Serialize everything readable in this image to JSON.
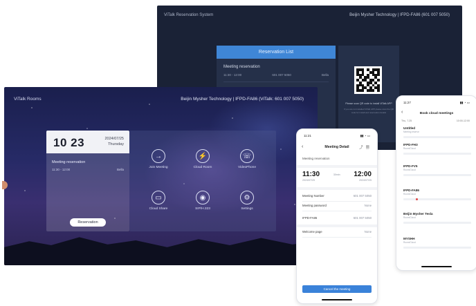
{
  "back_screen": {
    "title": "ViTalk Reservation System",
    "company": "Beijin Mysher Technology  |  IFPD-FA86  (601 007 5050)",
    "panel_title": "Reservation List",
    "reservation": {
      "title": "Meeting reservation",
      "time": "11:30 - 12:00",
      "id": "601 007 5050",
      "user": "Bella"
    },
    "qr_caption": "Please scan QR code to install ViTalk APP",
    "qr_note": "If you are not installed ViTalk APP please scan the QR code for install and reservation details"
  },
  "main_screen": {
    "title": "ViTalk Rooms",
    "company": "Beijin Mysher Technology  |  IFPD-FA86  (ViTalk: 601 007 5050)",
    "clock": {
      "time": "10 23",
      "date": "2024/07/25",
      "weekday": "Thursday"
    },
    "reservation": {
      "title": "Meeting reservation",
      "time": "11:30 - 12:00",
      "user": "Bella"
    },
    "reservation_button": "Reservation",
    "functions": [
      {
        "label": "Join Meeting",
        "icon": "arrow-right-icon",
        "glyph": "→"
      },
      {
        "label": "Cloud Room",
        "icon": "lightning-icon",
        "glyph": "⚡"
      },
      {
        "label": "VideoPhone",
        "icon": "phone-icon",
        "glyph": "☏"
      },
      {
        "label": "Cloud Share",
        "icon": "screen-share-icon",
        "glyph": "▭"
      },
      {
        "label": "SIP/H.323",
        "icon": "sip-icon",
        "glyph": "◉"
      },
      {
        "label": "Settings",
        "icon": "gear-icon",
        "glyph": "⚙"
      }
    ]
  },
  "phone_meeting": {
    "status_time": "11:21",
    "status_icons": "▮▮ ◔ ▭",
    "nav_title": "Meeting Detail",
    "subject": "Meeting reservation",
    "start_time": "11:30",
    "start_date": "2024/07/25",
    "duration": "30min",
    "end_time": "12:00",
    "end_date": "2024/07/25",
    "rows": [
      {
        "label": "Meeting Number",
        "value": "601 007 5050"
      },
      {
        "label": "Meeting password",
        "value": "None"
      },
      {
        "label": "IFPD-FA86",
        "value": "601 007 5050"
      },
      {
        "label": "Welcome page",
        "value": "None"
      }
    ],
    "button": "Cancel the meeting"
  },
  "phone_book": {
    "status_time": "11:27",
    "status_icons": "▮▮ ◔ ▭",
    "nav_title": "Book cloud meetings",
    "date": "Thu, 7.25",
    "date_right": "10:00-12:00",
    "items": [
      {
        "name": "Untitled",
        "sub": "Meeting reserve"
      },
      {
        "name": "IFPD-FH3",
        "sub": "Room/Cloud"
      },
      {
        "name": "IFPD-FV5",
        "sub": "Room/Cloud"
      },
      {
        "name": "IFPD-FA86",
        "sub": "Room/Cloud"
      },
      {
        "name": "Beijin Mysher Tesla",
        "sub": "Room/Cloud"
      },
      {
        "name": "MYSHH",
        "sub": "Room/Cloud"
      }
    ]
  }
}
